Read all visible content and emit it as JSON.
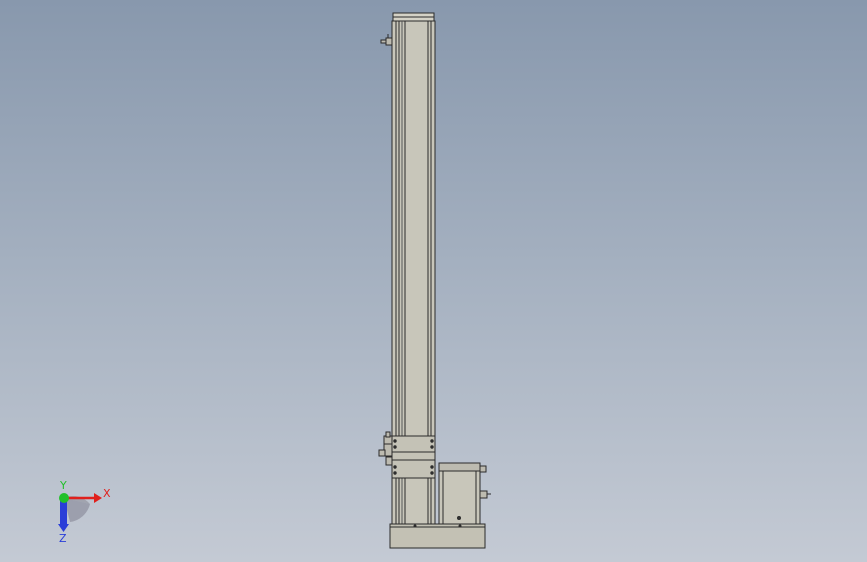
{
  "viewport": {
    "background_top": "#8898ad",
    "background_bottom": "#c4cad4"
  },
  "model": {
    "face_color": "#c8c6ba",
    "edge_color": "#2a2a2a",
    "base_color": "#c3c1b4"
  },
  "triad": {
    "x_label": "X",
    "y_label": "Y",
    "z_label": "Z",
    "x_color": "#e0201c",
    "y_color": "#22c02a",
    "z_color": "#2a3ed8"
  }
}
